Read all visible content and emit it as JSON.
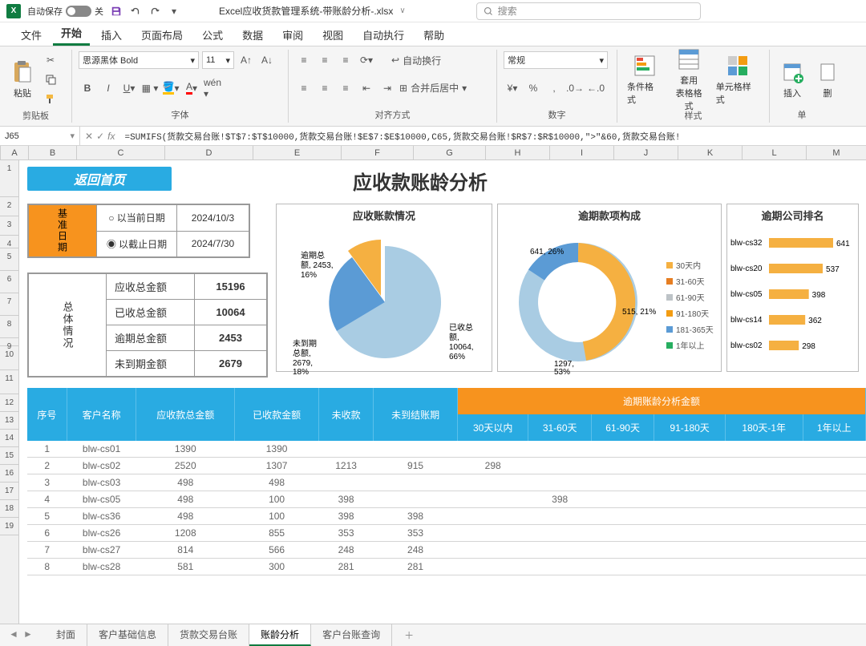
{
  "titlebar": {
    "autosave": "自动保存",
    "off": "关",
    "filename": "Excel应收货款管理系统-带账龄分析-.xlsx",
    "search_ph": "搜索"
  },
  "tabs": [
    "文件",
    "开始",
    "插入",
    "页面布局",
    "公式",
    "数据",
    "审阅",
    "视图",
    "自动执行",
    "帮助"
  ],
  "active_tab": 1,
  "ribbon": {
    "paste": "粘贴",
    "clipboard": "剪贴板",
    "font": "字体",
    "align": "对齐方式",
    "number": "数字",
    "styles": "样式",
    "cells": "单",
    "font_name": "思源黑体 Bold",
    "font_size": "11",
    "wrap": "自动换行",
    "merge": "合并后居中",
    "num_fmt": "常规",
    "cond_fmt": "条件格式",
    "tbl_fmt": "套用\n表格格式",
    "cell_fmt": "单元格样式",
    "insert": "插入",
    "del": "删"
  },
  "namebox": "J65",
  "formula": "=SUMIFS(货款交易台账!$T$7:$T$10000,货款交易台账!$E$7:$E$10000,C65,货款交易台账!$R$7:$R$10000,\">\"&60,货款交易台账!",
  "cols": [
    "A",
    "B",
    "C",
    "D",
    "E",
    "F",
    "G",
    "H",
    "I",
    "J",
    "K",
    "L",
    "M"
  ],
  "rowstart": [
    "1",
    "2",
    "3",
    "4",
    "5",
    "6",
    "7",
    "8",
    "9",
    "10",
    "11",
    "12",
    "13",
    "14",
    "15",
    "16",
    "17",
    "18",
    "19"
  ],
  "btn_home": "返回首页",
  "page_title": "应收款账龄分析",
  "date_block": {
    "label": "基准日期",
    "opt1": "以当前日期",
    "opt2": "以截止日期",
    "d1": "2024/10/3",
    "d2": "2024/7/30"
  },
  "summary": {
    "label": "总体情况",
    "rows": [
      [
        "应收总金额",
        "15196"
      ],
      [
        "已收总金额",
        "10064"
      ],
      [
        "逾期总金额",
        "2453"
      ],
      [
        "未到期金额",
        "2679"
      ]
    ]
  },
  "chart1": {
    "title": "应收账款情况"
  },
  "chart2": {
    "title": "逾期款项构成"
  },
  "chart3": {
    "title": "逾期公司排名"
  },
  "donut_legend": [
    "30天内",
    "31-60天",
    "61-90天",
    "91-180天",
    "181-365天",
    "1年以上"
  ],
  "bar_data": [
    [
      "blw-cs32",
      "641"
    ],
    [
      "blw-cs20",
      "537"
    ],
    [
      "blw-cs05",
      "398"
    ],
    [
      "blw-cs14",
      "362"
    ],
    [
      "blw-cs02",
      "298"
    ]
  ],
  "table": {
    "h1": [
      "序号",
      "客户名称",
      "应收款总金额",
      "已收款金额",
      "未收款",
      "未到结账期"
    ],
    "h_orange": "逾期账龄分析金额",
    "h2": [
      "30天以内",
      "31-60天",
      "61-90天",
      "91-180天",
      "180天-1年",
      "1年以上"
    ],
    "rows": [
      [
        "1",
        "blw-cs01",
        "1390",
        "1390",
        "",
        "",
        "",
        "",
        "",
        "",
        "",
        ""
      ],
      [
        "2",
        "blw-cs02",
        "2520",
        "1307",
        "1213",
        "915",
        "298",
        "",
        "",
        "",
        "",
        ""
      ],
      [
        "3",
        "blw-cs03",
        "498",
        "498",
        "",
        "",
        "",
        "",
        "",
        "",
        "",
        ""
      ],
      [
        "4",
        "blw-cs05",
        "498",
        "100",
        "398",
        "",
        "",
        "398",
        "",
        "",
        "",
        ""
      ],
      [
        "5",
        "blw-cs36",
        "498",
        "100",
        "398",
        "398",
        "",
        "",
        "",
        "",
        "",
        ""
      ],
      [
        "6",
        "blw-cs26",
        "1208",
        "855",
        "353",
        "353",
        "",
        "",
        "",
        "",
        "",
        ""
      ],
      [
        "7",
        "blw-cs27",
        "814",
        "566",
        "248",
        "248",
        "",
        "",
        "",
        "",
        "",
        ""
      ],
      [
        "8",
        "blw-cs28",
        "581",
        "300",
        "281",
        "281",
        "",
        "",
        "",
        "",
        "",
        ""
      ]
    ]
  },
  "chart_data": {
    "pie": {
      "type": "pie",
      "title": "应收账款情况",
      "series": [
        {
          "name": "已收总额",
          "value": 10064,
          "pct": 66
        },
        {
          "name": "未到期总额",
          "value": 2679,
          "pct": 18
        },
        {
          "name": "逾期总额",
          "value": 2453,
          "pct": 16
        }
      ]
    },
    "donut": {
      "type": "pie",
      "title": "逾期款项构成",
      "series": [
        {
          "name": "30天内",
          "value": 1297,
          "pct": 53
        },
        {
          "name": "31-60天",
          "value": 515,
          "pct": 21
        },
        {
          "name": "61-90天",
          "value": 641,
          "pct": 26
        }
      ]
    },
    "bars": {
      "type": "bar",
      "title": "逾期公司排名",
      "categories": [
        "blw-cs32",
        "blw-cs20",
        "blw-cs05",
        "blw-cs14",
        "blw-cs02"
      ],
      "values": [
        641,
        537,
        398,
        362,
        298
      ]
    }
  },
  "sheets": [
    "封面",
    "客户基础信息",
    "货款交易台账",
    "账龄分析",
    "客户台账查询"
  ],
  "active_sheet": 3
}
